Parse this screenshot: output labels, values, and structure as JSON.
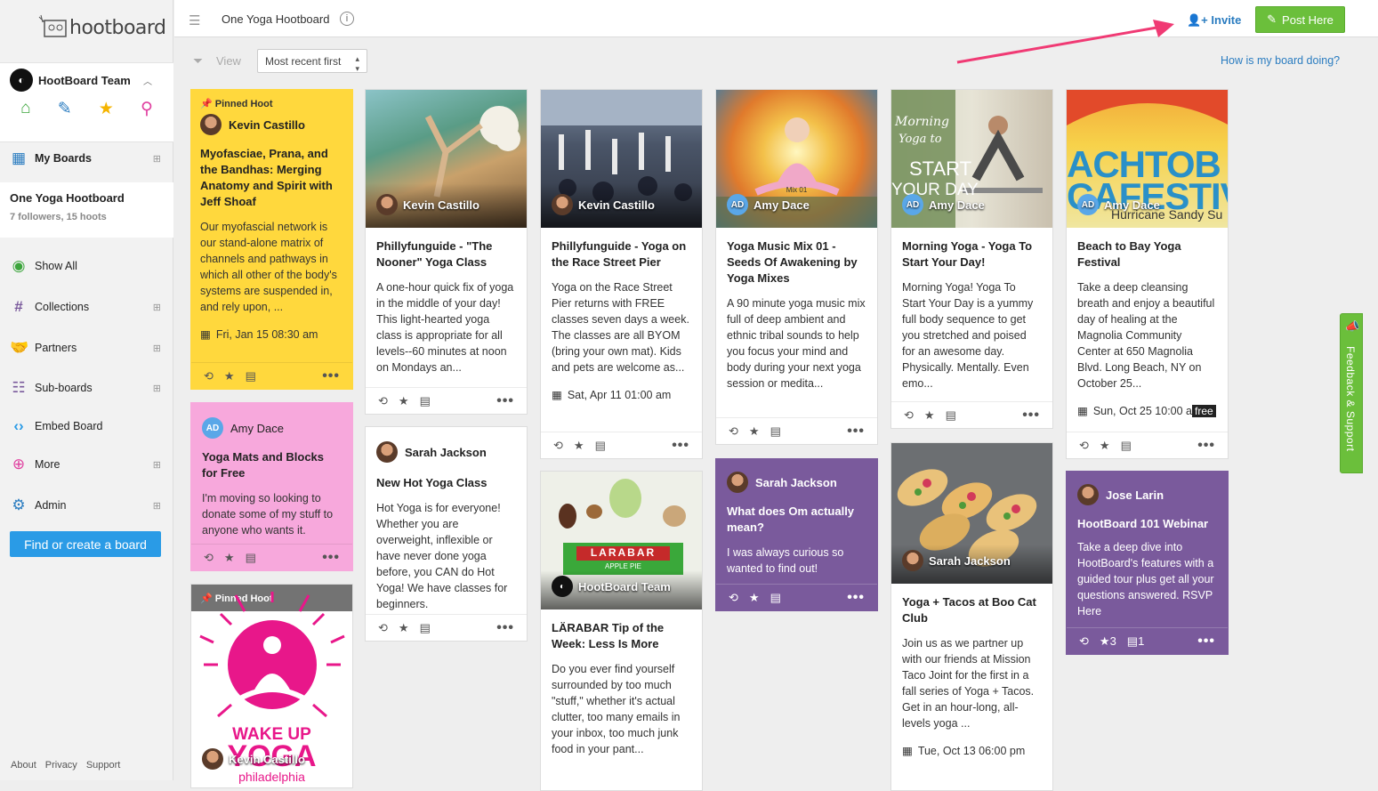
{
  "app": {
    "logo_text": "hootboard"
  },
  "sidebar": {
    "team_name": "HootBoard Team",
    "quick_icons": [
      "home-icon",
      "edit-icon",
      "star-icon",
      "location-icon"
    ],
    "my_boards": "My Boards",
    "current_board": {
      "title": "One Yoga Hootboard",
      "stats": "7 followers, 15 hoots"
    },
    "items": [
      {
        "label": "Show All",
        "icon": "eye-icon"
      },
      {
        "label": "Collections",
        "icon": "hash-icon"
      },
      {
        "label": "Partners",
        "icon": "handshake-icon"
      },
      {
        "label": "Sub-boards",
        "icon": "subboards-icon"
      },
      {
        "label": "Embed Board",
        "icon": "code-icon"
      },
      {
        "label": "More",
        "icon": "plus-circle-icon"
      },
      {
        "label": "Admin",
        "icon": "gear-icon"
      }
    ],
    "find_button": "Find or create a board",
    "footer": [
      "About",
      "Privacy",
      "Support"
    ]
  },
  "topbar": {
    "title": "One Yoga Hootboard",
    "invite": "Invite",
    "post": "Post Here"
  },
  "toolbar": {
    "view": "View",
    "sort": "Most recent first",
    "how": "How is my board doing?"
  },
  "feedback": "Feedback & Support",
  "cards": {
    "c1": {
      "pinned": "Pinned Hoot",
      "user": "Kevin Castillo",
      "title": "Myofasciae, Prana, and the Bandhas: Merging Anatomy and Spirit with Jeff Shoaf",
      "desc": "Our myofascial network is our stand-alone matrix of channels and pathways in which all other of the body's systems are suspended in, and rely upon, ...",
      "date": "Fri, Jan 15 08:30 am"
    },
    "c2": {
      "user": "Amy Dace",
      "initials": "AD",
      "title": "Yoga Mats and Blocks for Free",
      "desc": "I'm moving so looking to donate some of my stuff to anyone who wants it."
    },
    "c3": {
      "pinned": "Pinned Hoot",
      "user": "Kevin Castillo",
      "img_text1": "WAKE UP",
      "img_text2": "YOGA",
      "img_text3": "philadelphia"
    },
    "c4": {
      "user": "Kevin Castillo",
      "title": "Phillyfunguide - \"The Nooner\" Yoga Class",
      "desc": "A one-hour quick fix of yoga in the middle of your day! This light-hearted yoga class is appropriate for all levels--60 minutes at noon on Mondays an..."
    },
    "c5": {
      "user": "Sarah Jackson",
      "title": "New Hot Yoga Class",
      "desc": "Hot Yoga is for everyone! Whether you are overweight, inflexible or have never done yoga before, you CAN do Hot Yoga! We have classes for beginners."
    },
    "c6": {
      "user": "Kevin Castillo",
      "title": "Phillyfunguide - Yoga on the Race Street Pier",
      "desc": "Yoga on the Race Street Pier returns with FREE classes seven days a week. The classes are all BYOM (bring your own mat). Kids and pets are welcome as...",
      "date": "Sat, Apr 11 01:00 am"
    },
    "c7": {
      "user": "HootBoard Team",
      "img_text": "LARABAR",
      "img_sub": "APPLE PIE",
      "title": "LÄRABAR Tip of the Week: Less Is More",
      "desc": "Do you ever find yourself surrounded by too much \"stuff,\" whether it's actual clutter, too many emails in your inbox, too much junk food in your pant..."
    },
    "c8": {
      "user": "Amy Dace",
      "initials": "AD",
      "img_text": "Mix 01",
      "title": "Yoga Music Mix 01 - Seeds Of Awakening by Yoga Mixes",
      "desc": "A 90 minute yoga music mix full of deep ambient and ethnic tribal sounds to help you focus your mind and body during your next yoga session or medita..."
    },
    "c9": {
      "user": "Sarah Jackson",
      "title": "What does Om actually mean?",
      "desc": "I was always curious so wanted to find out!"
    },
    "c10": {
      "user": "Amy Dace",
      "initials": "AD",
      "img_text1": "Morning",
      "img_text2": "Yoga to",
      "img_text3": "START",
      "img_text4": "YOUR DAY",
      "title": "Morning Yoga - Yoga To Start Your Day!",
      "desc": "Morning Yoga! Yoga To Start Your Day is a yummy full body sequence to get you stretched and poised for an awesome day. Physically. Mentally. Even emo..."
    },
    "c11": {
      "user": "Sarah Jackson",
      "title": "Yoga + Tacos at Boo Cat Club",
      "desc": "Join us as we partner up with our friends at Mission Taco Joint for the first in a fall series of Yoga + Tacos. Get in an hour-long, all-levels yoga ...",
      "date": "Tue, Oct 13 06:00 pm"
    },
    "c12": {
      "user": "Amy Dace",
      "initials": "AD",
      "img_text1": "ACHTOB",
      "img_text2": "CAFESTIV",
      "img_text3": "Hurricane Sandy Su",
      "title": "Beach to Bay Yoga Festival",
      "desc": "Take a deep cleansing breath and enjoy a beautiful day of healing at the Magnolia Community Center at 650 Magnolia Blvd. Long Beach, NY on October 25...",
      "date": "Sun, Oct 25 10:00 a",
      "tag": "free"
    },
    "c13": {
      "user": "Jose Larin",
      "title": "HootBoard 101 Webinar",
      "desc": "Take a deep dive into HootBoard's features with a guided tour plus get all your questions answered. RSVP Here",
      "stars": "3",
      "comments": "1"
    }
  }
}
